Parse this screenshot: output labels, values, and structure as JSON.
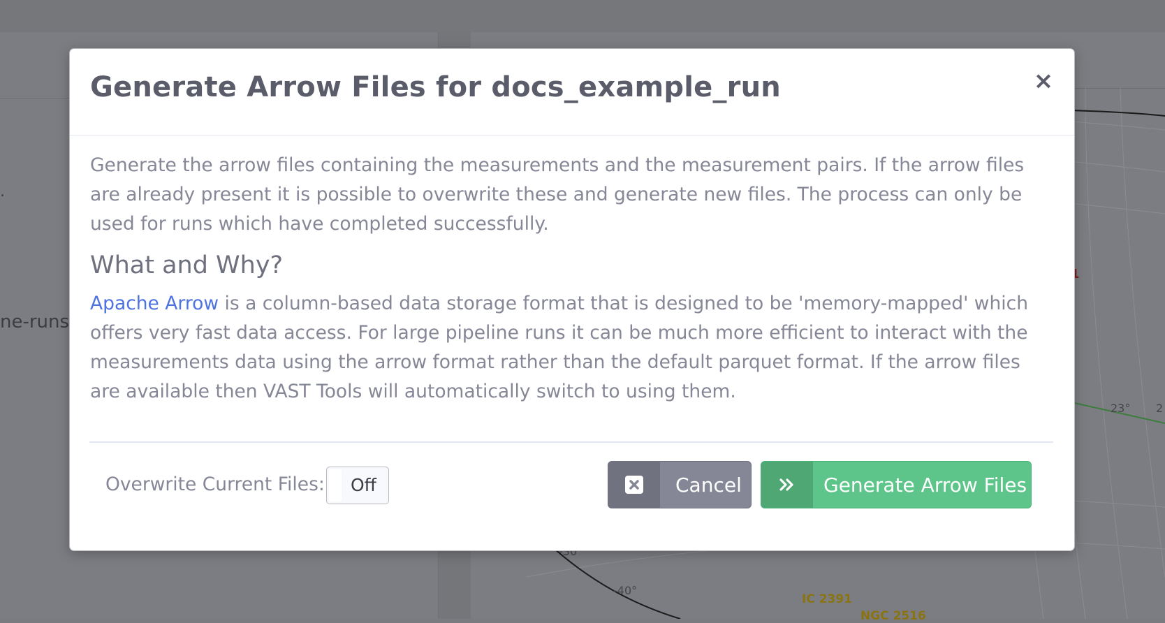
{
  "background": {
    "left_text": "ne-runs",
    "left_dot": ".",
    "sky_labels": [
      "23°",
      "2",
      "-30",
      "-40°"
    ],
    "objects": [
      "IC 2391",
      "NGC 2516"
    ],
    "red_mark": "1"
  },
  "modal": {
    "title": "Generate Arrow Files for docs_example_run",
    "close_label": "×",
    "intro": "Generate the arrow files containing the measurements and the measurement pairs. If the arrow files are already present it is possible to overwrite these and generate new files. The process can only be used for runs which have completed successfully.",
    "section_title": "What and Why?",
    "link_text": "Apache Arrow",
    "body_text": " is a column-based data storage format that is designed to be 'memory-mapped' which offers very fast data access. For large pipeline runs it can be much more efficient to interact with the measurements data using the arrow format rather than the default parquet format. If the arrow files are available then VAST Tools will automatically switch to using them.",
    "overwrite_label": "Overwrite Current Files:",
    "overwrite_state": "Off",
    "cancel_label": "Cancel",
    "generate_label": "Generate Arrow Files"
  },
  "icons": {
    "cancel": "close-box-icon",
    "generate": "double-chevron-right-icon",
    "close": "close-icon"
  },
  "colors": {
    "primary_link": "#4e73df",
    "success": "#5dc589",
    "secondary": "#858796"
  }
}
